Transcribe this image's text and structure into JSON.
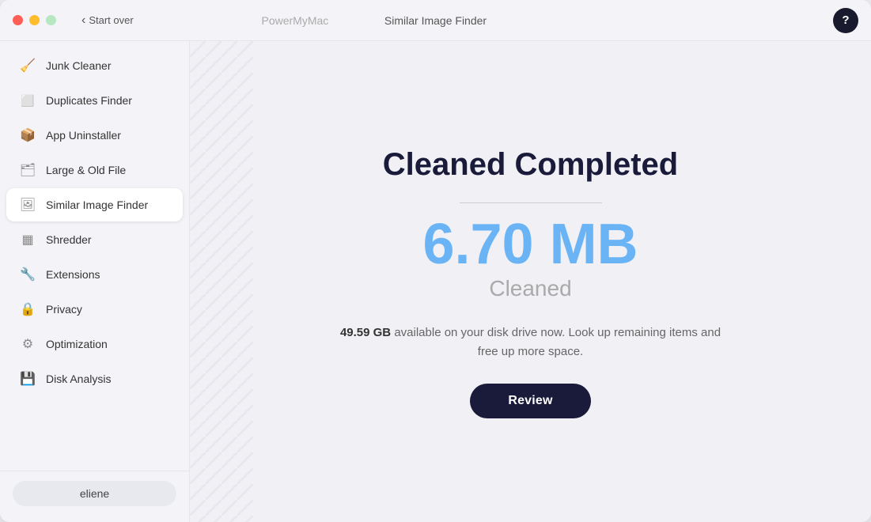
{
  "titlebar": {
    "app_name": "PowerMyMac",
    "start_over_label": "Start over",
    "page_title": "Similar Image Finder",
    "help_label": "?"
  },
  "sidebar": {
    "items": [
      {
        "id": "junk-cleaner",
        "label": "Junk Cleaner",
        "icon": "junk"
      },
      {
        "id": "duplicates-finder",
        "label": "Duplicates Finder",
        "icon": "duplicates"
      },
      {
        "id": "app-uninstaller",
        "label": "App Uninstaller",
        "icon": "uninstaller"
      },
      {
        "id": "large-old-file",
        "label": "Large & Old File",
        "icon": "large-file"
      },
      {
        "id": "similar-image-finder",
        "label": "Similar Image Finder",
        "icon": "image",
        "active": true
      },
      {
        "id": "shredder",
        "label": "Shredder",
        "icon": "shredder"
      },
      {
        "id": "extensions",
        "label": "Extensions",
        "icon": "extensions"
      },
      {
        "id": "privacy",
        "label": "Privacy",
        "icon": "privacy"
      },
      {
        "id": "optimization",
        "label": "Optimization",
        "icon": "optimization"
      },
      {
        "id": "disk-analysis",
        "label": "Disk Analysis",
        "icon": "disk"
      }
    ],
    "user": {
      "name": "eliene"
    }
  },
  "content": {
    "result_title": "Cleaned Completed",
    "cleaned_size": "6.70 MB",
    "cleaned_label": "Cleaned",
    "disk_info_bold": "49.59 GB",
    "disk_info_text": " available on your disk drive now. Look up remaining items and free up more space.",
    "review_button_label": "Review"
  }
}
